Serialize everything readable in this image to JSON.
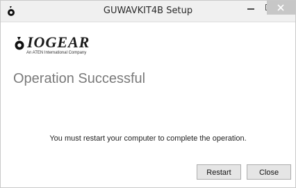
{
  "window": {
    "title": "GUWAVKIT4B Setup",
    "app_icon": "iogear-logo-icon"
  },
  "logo": {
    "brand": "IOGEAR",
    "tagline": "An ATEN International Company"
  },
  "page": {
    "heading": "Operation Successful",
    "message": "You must restart your computer to complete the operation."
  },
  "buttons": {
    "restart": "Restart",
    "close": "Close"
  },
  "colors": {
    "titlebar_bg": "#f0f0f0",
    "heading": "#7a7a7a",
    "button_bg": "#e5e5e5"
  }
}
